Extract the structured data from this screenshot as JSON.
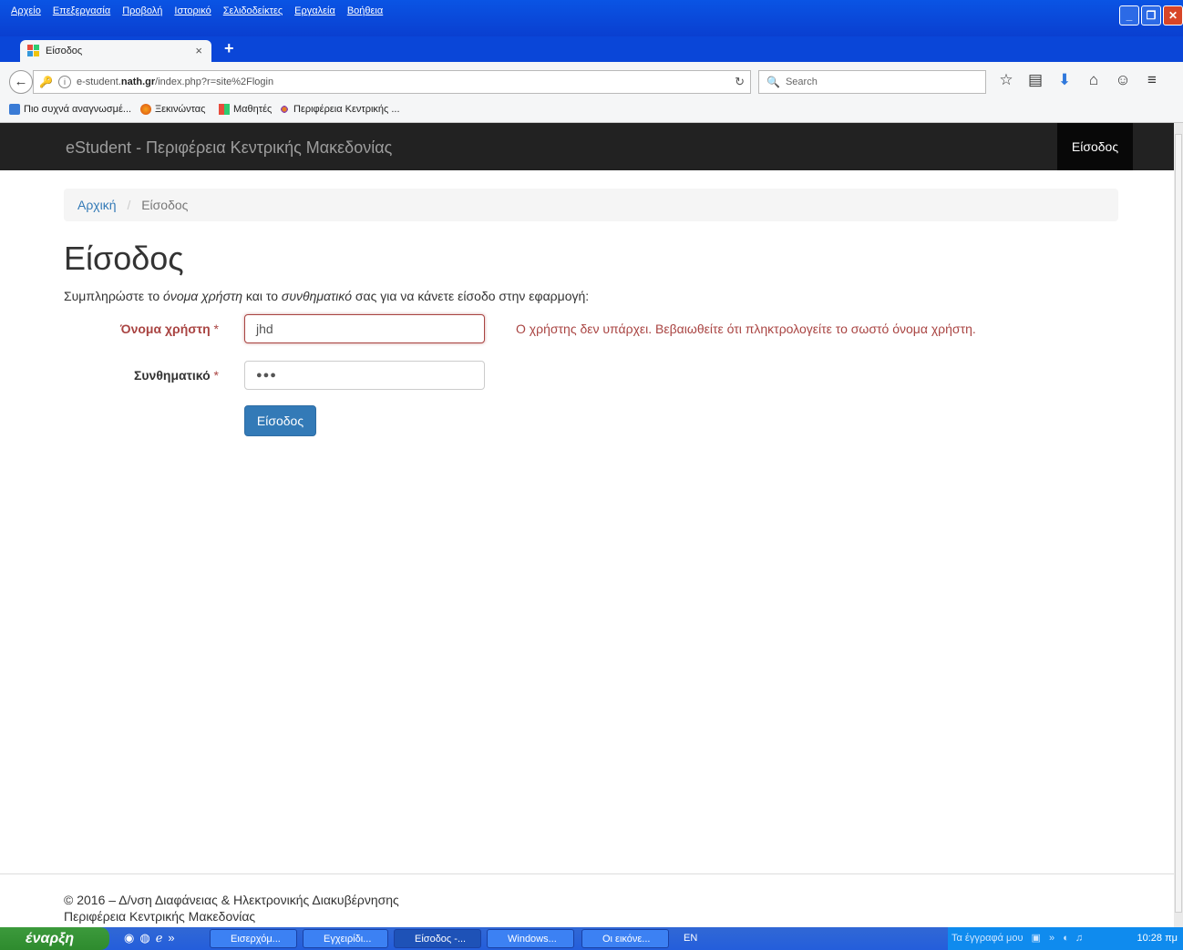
{
  "menubar": {
    "items": [
      "Αρχείο",
      "Επεξεργασία",
      "Προβολή",
      "Ιστορικό",
      "Σελιδοδείκτες",
      "Εργαλεία",
      "Βοήθεια"
    ]
  },
  "tab": {
    "title": "Είσοδος",
    "close": "×",
    "new": "+"
  },
  "nav": {
    "url_prefix": "e-student.",
    "url_domain": "nath.gr",
    "url_path": "/index.php?r=site%2Flogin",
    "search_placeholder": "Search"
  },
  "bookmarks": [
    "Πιο συχνά αναγνωσμέ...",
    "Ξεκινώντας",
    "Μαθητές",
    "Περιφέρεια Κεντρικής ..."
  ],
  "site": {
    "brand": "eStudent - Περιφέρεια Κεντρικής Μακεδονίας",
    "nav_login": "Είσοδος"
  },
  "breadcrumb": {
    "home": "Αρχική",
    "sep": "/",
    "current": "Είσοδος"
  },
  "page": {
    "title": "Είσοδος",
    "intro_1": "Συμπληρώστε το ",
    "intro_em1": "όνομα χρήστη",
    "intro_2": " και το ",
    "intro_em2": "συνθηματικό",
    "intro_3": " σας για να κάνετε είσοδο στην εφαρμογή:"
  },
  "form": {
    "username_label": "Όνομα χρήστη",
    "username_value": "jhd",
    "password_label": "Συνθηματικό",
    "password_value": "●●●",
    "required_mark": "*",
    "error": "Ο χρήστης δεν υπάρχει. Βεβαιωθείτε ότι πληκτρολογείτε το σωστό όνομα χρήστη.",
    "submit": "Είσοδος"
  },
  "footer": {
    "line1": "© 2016 – Δ/νση Διαφάνειας & Ηλεκτρονικής Διακυβέρνησης",
    "line2": "Περιφέρεια Κεντρικής Μακεδονίας"
  },
  "taskbar": {
    "start": "έναρξη",
    "tasks": [
      "Εισερχόμ...",
      "Εγχειρίδι...",
      "Είσοδος -...",
      "Windows...",
      "Οι εικόνε..."
    ],
    "lang": "EN",
    "tray_text": "Τα έγγραφά μου",
    "clock": "10:28 πμ"
  },
  "colors": {
    "primary": "#337ab7",
    "error": "#a94442",
    "navbar": "#222222"
  }
}
